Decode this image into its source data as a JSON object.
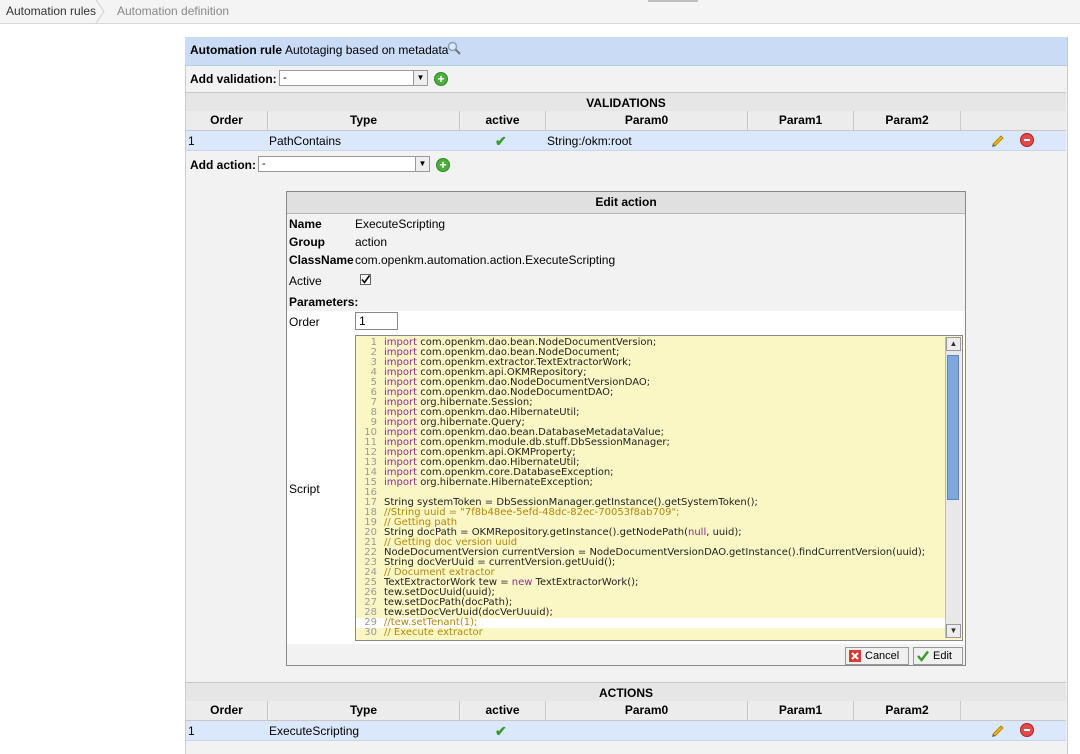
{
  "breadcrumb": {
    "item1": "Automation rules",
    "item2": "Automation definition"
  },
  "rule": {
    "label": "Automation rule",
    "name": "Autotaging based on metadata"
  },
  "add_validation": {
    "label": "Add validation:",
    "selected": "-"
  },
  "validations": {
    "title": "VALIDATIONS",
    "columns": [
      "Order",
      "Type",
      "active",
      "Param0",
      "Param1",
      "Param2"
    ],
    "rows": [
      {
        "order": "1",
        "type": "PathContains",
        "param0": "String:/okm:root"
      }
    ]
  },
  "add_action": {
    "label": "Add action:",
    "selected": "-"
  },
  "edit_action": {
    "title": "Edit action",
    "name_label": "Name",
    "name_value": "ExecuteScripting",
    "group_label": "Group",
    "group_value": "action",
    "classname_label": "ClassName",
    "classname_value": "com.openkm.automation.action.ExecuteScripting",
    "active_label": "Active",
    "parameters_label": "Parameters:",
    "order_label": "Order",
    "order_value": "1",
    "script_label": "Script",
    "cancel_label": "Cancel",
    "edit_label": "Edit"
  },
  "script_lines": [
    {
      "n": "1",
      "t": "import",
      "r": " com.openkm.dao.bean.NodeDocumentVersion;"
    },
    {
      "n": "2",
      "t": "import",
      "r": " com.openkm.dao.bean.NodeDocument;"
    },
    {
      "n": "3",
      "t": "import",
      "r": " com.openkm.extractor.TextExtractorWork;"
    },
    {
      "n": "4",
      "t": "import",
      "r": " com.openkm.api.OKMRepository;"
    },
    {
      "n": "5",
      "t": "import",
      "r": " com.openkm.dao.NodeDocumentVersionDAO;"
    },
    {
      "n": "6",
      "t": "import",
      "r": " com.openkm.dao.NodeDocumentDAO;"
    },
    {
      "n": "7",
      "t": "import",
      "r": " org.hibernate.Session;"
    },
    {
      "n": "8",
      "t": "import",
      "r": " com.openkm.dao.HibernateUtil;"
    },
    {
      "n": "9",
      "t": "import",
      "r": " org.hibernate.Query;"
    },
    {
      "n": "10",
      "t": "import",
      "r": " com.openkm.dao.bean.DatabaseMetadataValue;"
    },
    {
      "n": "11",
      "t": "import",
      "r": " com.openkm.module.db.stuff.DbSessionManager;"
    },
    {
      "n": "12",
      "t": "import",
      "r": " com.openkm.api.OKMProperty;"
    },
    {
      "n": "13",
      "t": "import",
      "r": " com.openkm.dao.HibernateUtil;"
    },
    {
      "n": "14",
      "t": "import",
      "r": " com.openkm.core.DatabaseException;"
    },
    {
      "n": "15",
      "t": "import",
      "r": " org.hibernate.HibernateException;"
    },
    {
      "n": "16",
      "t": "",
      "r": ""
    },
    {
      "n": "17",
      "t": "",
      "r": "String systemToken = DbSessionManager.getInstance().getSystemToken();"
    },
    {
      "n": "18",
      "t": "",
      "r": "//String uuid = \"7f8b48ee-5efd-48dc-82ec-70053f8ab709\";",
      "c": true
    },
    {
      "n": "19",
      "t": "",
      "r": "// Getting path",
      "c": true
    },
    {
      "n": "20",
      "t": "",
      "r": "String docPath = OKMRepository.getInstance().getNodePath(",
      "k": "null",
      "r2": ", uuid);"
    },
    {
      "n": "21",
      "t": "",
      "r": "// Getting doc version uuid",
      "c": true
    },
    {
      "n": "22",
      "t": "",
      "r": "NodeDocumentVersion currentVersion = NodeDocumentVersionDAO.getInstance().findCurrentVersion(uuid);"
    },
    {
      "n": "23",
      "t": "",
      "r": "String docVerUuid = currentVersion.getUuid();"
    },
    {
      "n": "24",
      "t": "",
      "r": "// Document extractor",
      "c": true
    },
    {
      "n": "25",
      "t": "",
      "r": "TextExtractorWork tew = ",
      "k": "new",
      "r2": " TextExtractorWork();"
    },
    {
      "n": "26",
      "t": "",
      "r": "tew.setDocUuid(uuid);"
    },
    {
      "n": "27",
      "t": "",
      "r": "tew.setDocPath(docPath);"
    },
    {
      "n": "28",
      "t": "",
      "r": "tew.setDocVerUuid(docVerUuuid);"
    },
    {
      "n": "29",
      "t": "",
      "r": "//tew.setTenant(1);",
      "c": true
    },
    {
      "n": "30",
      "t": "",
      "r": "// Execute extractor",
      "c": true
    }
  ],
  "actions": {
    "title": "ACTIONS",
    "columns": [
      "Order",
      "Type",
      "active",
      "Param0",
      "Param1",
      "Param2"
    ],
    "rows": [
      {
        "order": "1",
        "type": "ExecuteScripting",
        "param0": ""
      }
    ]
  },
  "colors": {
    "rule_bar": "#c9dbf5",
    "row_highlight": "#dbe8fb",
    "editor_bg": "#fbf7c4",
    "keyword": "#8d2e8f",
    "comment": "#b7860b"
  }
}
